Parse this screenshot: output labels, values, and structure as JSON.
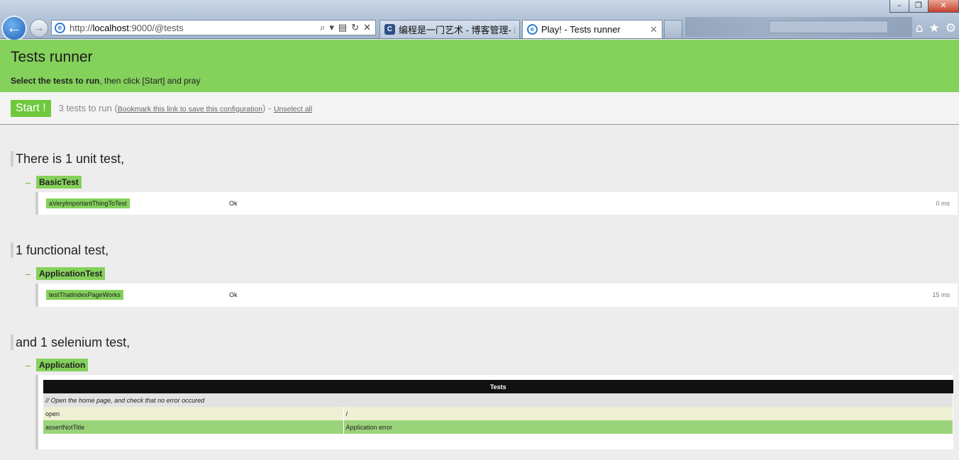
{
  "browser": {
    "url_prefix": "http://",
    "url_host": "localhost",
    "url_rest": ":9000/@tests",
    "tabs": [
      {
        "label": "编程是一门艺术 - 博客管理- I..."
      },
      {
        "label": "Play! - Tests runner"
      }
    ],
    "window_buttons": [
      "–",
      "❐",
      "✕"
    ]
  },
  "header": {
    "title": "Tests runner",
    "subtitle_bold": "Select the tests to run",
    "subtitle_rest": ", then click [Start] and pray"
  },
  "toolbar": {
    "start_label": "Start !",
    "count_text": "3 tests to run (",
    "bookmark_link": "Bookmark this link to save this configuration",
    "separator": ") - ",
    "unselect_link": "Unselect all"
  },
  "sections": [
    {
      "title": "There is 1 unit test,",
      "class_name": "BasicTest",
      "tests": [
        {
          "name": "aVeryImportantThingToTest",
          "status": "Ok",
          "time": "0 ms"
        }
      ]
    },
    {
      "title": "1 functional test,",
      "class_name": "ApplicationTest",
      "tests": [
        {
          "name": "testThatIndexPageWorks",
          "status": "Ok",
          "time": "15 ms"
        }
      ]
    },
    {
      "title": "and 1 selenium test,",
      "class_name": "Application",
      "table": {
        "header": "Tests",
        "comment": "// Open the home page, and check that no error occured",
        "rows": [
          {
            "command": "open",
            "target": "/"
          },
          {
            "command": "assertNotTitle",
            "target": "Application error"
          }
        ]
      }
    }
  ],
  "colors": {
    "accent": "#84d15b",
    "start": "#6ec93c"
  }
}
